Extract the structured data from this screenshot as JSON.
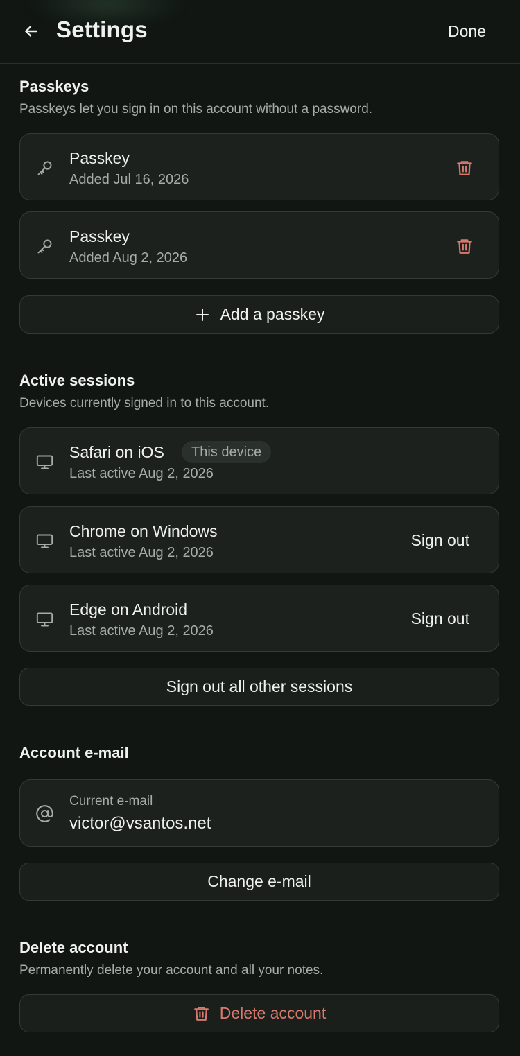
{
  "header": {
    "title": "Settings",
    "done_label": "Done"
  },
  "passkeys": {
    "title": "Passkeys",
    "subtitle": "Passkeys let you sign in on this account without a password.",
    "items": [
      {
        "name": "Passkey",
        "added": "Added Jul 16, 2026"
      },
      {
        "name": "Passkey",
        "added": "Added Aug 2, 2026"
      }
    ],
    "add_label": "Add a passkey"
  },
  "sessions": {
    "title": "Active sessions",
    "subtitle": "Devices currently signed in to this account.",
    "items": [
      {
        "name": "Safari on iOS",
        "badge": "This device",
        "last_active": "Last active Aug 2, 2026"
      },
      {
        "name": "Chrome on Windows",
        "last_active": "Last active Aug 2, 2026",
        "action": "Sign out"
      },
      {
        "name": "Edge on Android",
        "last_active": "Last active Aug 2, 2026",
        "action": "Sign out"
      }
    ],
    "sign_out_all_label": "Sign out all other sessions"
  },
  "account_email": {
    "title": "Account e-mail",
    "current_label": "Current e-mail",
    "current_value": "victor@vsantos.net",
    "change_label": "Change e-mail"
  },
  "delete_account": {
    "title": "Delete account",
    "subtitle": "Permanently delete your account and all your notes.",
    "button_label": "Delete account"
  },
  "colors": {
    "background": "#111613",
    "card": "#1c211e",
    "danger": "#d7796d",
    "muted": "#a6aca8"
  },
  "icons": [
    "back-arrow-icon",
    "key-icon",
    "trash-icon",
    "plus-icon",
    "monitor-icon",
    "at-icon"
  ]
}
